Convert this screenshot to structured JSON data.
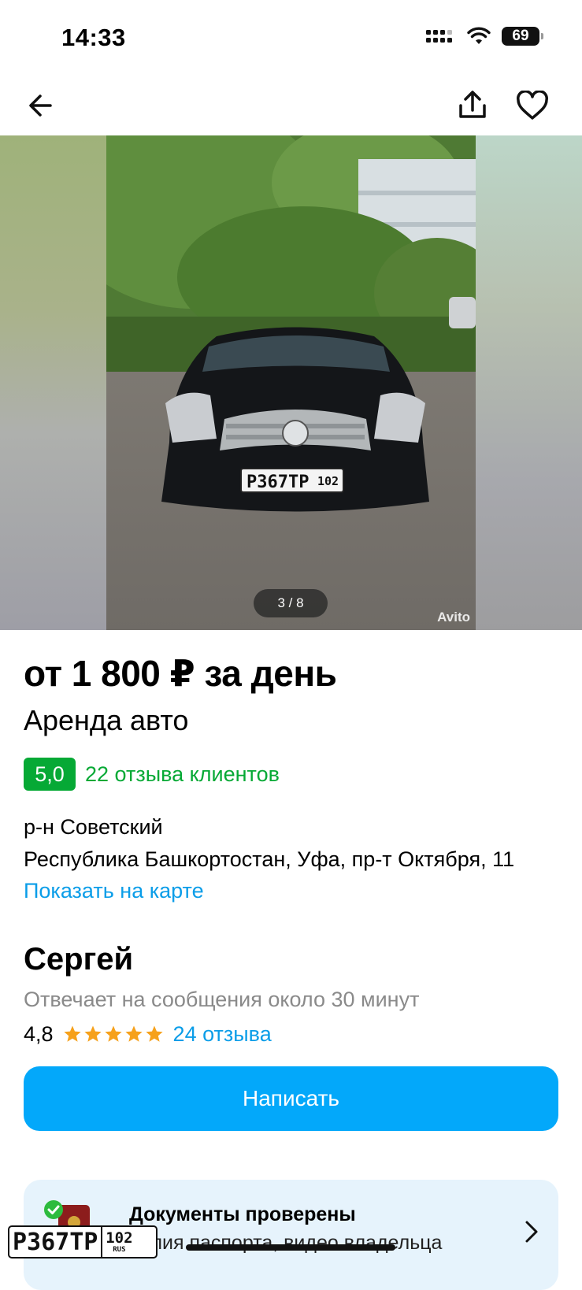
{
  "status_bar": {
    "time": "14:33",
    "battery": "69",
    "icons": [
      "cellular-signal-icon",
      "wifi-icon",
      "battery-icon"
    ]
  },
  "nav": {
    "icons": [
      "back-arrow-icon",
      "share-icon",
      "heart-icon"
    ]
  },
  "gallery": {
    "counter": "3 / 8",
    "watermark": "Avito",
    "plate": "Р367ТР",
    "plate_region": "102"
  },
  "listing": {
    "price": "от 1 800 ₽ за день",
    "category": "Аренда авто",
    "rating": "5,0",
    "reviews_label": "22 отзыва клиентов",
    "district": "р-н Советский",
    "address": "Республика Башкортостан, Уфа, пр-т Октября, 11",
    "map_link": "Показать на карте"
  },
  "seller": {
    "name": "Сергей",
    "response_time": "Отвечает на сообщения около 30 минут",
    "score": "4,8",
    "stars": 5,
    "reviews_label": "24 отзыва"
  },
  "actions": {
    "write_label": "Написать"
  },
  "docs_card": {
    "title": "Документы проверены",
    "subtitle": "Копия паспорта, видео владельца"
  },
  "overlay_plate": {
    "main": "Р367ТР",
    "region": "102",
    "country": "RUS"
  },
  "colors": {
    "accent_blue": "#03a8fa",
    "link_blue": "#0a9de8",
    "green": "#06a935",
    "star": "#f6a11b",
    "card_bg": "#e6f3fc"
  }
}
